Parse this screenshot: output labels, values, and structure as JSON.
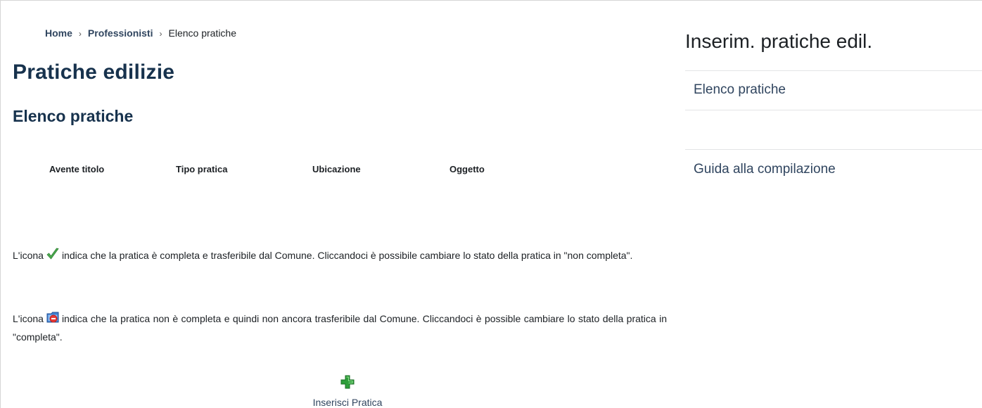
{
  "breadcrumb": {
    "home": "Home",
    "section": "Professionisti",
    "current": "Elenco pratiche",
    "separator": "›"
  },
  "page": {
    "title": "Pratiche edilizie",
    "subtitle": "Elenco pratiche"
  },
  "table": {
    "columns": [
      "Avente titolo",
      "Tipo pratica",
      "Ubicazione",
      "Oggetto"
    ]
  },
  "legend": {
    "complete_prefix": "L'icona",
    "complete_text": "indica che la pratica è completa e trasferibile dal Comune. Cliccandoci è possibile cambiare lo stato della pratica in \"non completa\".",
    "incomplete_prefix": "L'icona",
    "incomplete_text": "indica che la pratica non è completa e quindi non ancora trasferibile dal Comune. Cliccandoci è possible cambiare lo stato della pratica in \"completa\".",
    "complete_icon": "check-icon",
    "incomplete_icon": "incomplete-folder-icon"
  },
  "actions": {
    "add_label": "Inserisci Pratica",
    "add_icon": "plus-icon"
  },
  "sidebar": {
    "title": "Inserim. pratiche edil.",
    "links": [
      "Elenco pratiche",
      "Guida alla compilazione"
    ]
  },
  "colors": {
    "link": "#30455f",
    "heading": "#17324d",
    "check": "#4caf50",
    "plus": "#2e9e3a"
  }
}
